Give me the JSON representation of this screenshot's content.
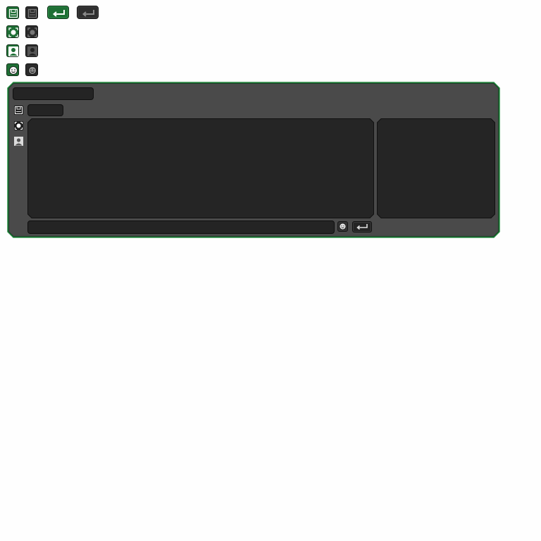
{
  "colors": {
    "accent": "#1f6f35",
    "panel_bg": "#4a4a4a",
    "panel_border": "#1f7a36",
    "field_bg": "#242424"
  },
  "sprites": {
    "rows": [
      {
        "icon": "save-icon"
      },
      {
        "icon": "target-icon"
      },
      {
        "icon": "user-icon"
      },
      {
        "icon": "emoji-icon"
      }
    ],
    "buttons": [
      {
        "icon": "enter-icon",
        "state": "active"
      },
      {
        "icon": "enter-icon",
        "state": "inactive"
      }
    ]
  },
  "chat": {
    "title": "",
    "channel": "",
    "message_input": {
      "value": "",
      "placeholder": ""
    },
    "side_icons": [
      "save-icon",
      "target-icon",
      "user-icon"
    ],
    "send_icon": "enter-icon",
    "emoji_icon": "emoji-icon"
  }
}
